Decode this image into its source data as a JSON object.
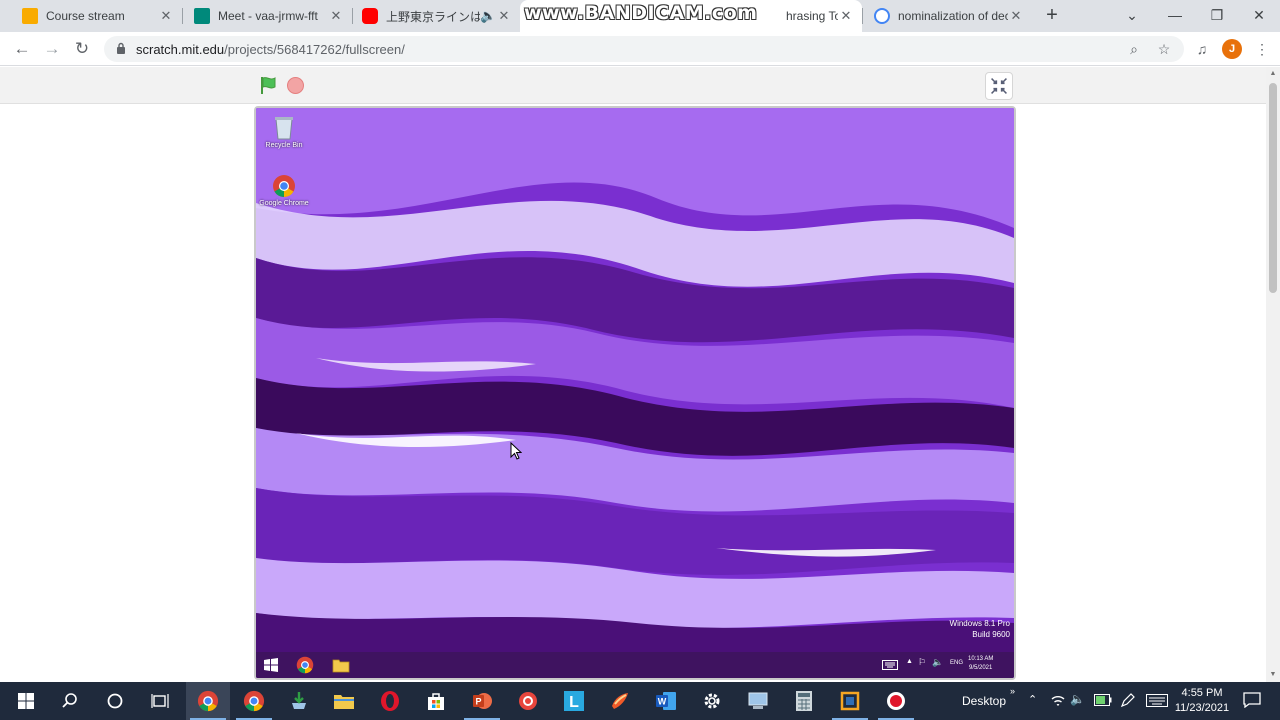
{
  "browser": {
    "tabs": [
      {
        "title": "Course stream",
        "favicon_color": "#f9ab00"
      },
      {
        "title": "Meet - vaa-jrmw-fft",
        "favicon_color": "#00897b"
      },
      {
        "title": "上野東京ラインは大",
        "favicon_color": "#ff0000"
      },
      {
        "title": "hrasing Tool | Qu",
        "favicon_color": "#1a73e8"
      },
      {
        "title": "nominalization of dec",
        "favicon_color": "#4285f4"
      }
    ],
    "active_tab_index": 3,
    "watermark": "www.BANDICAM.com",
    "url": {
      "host": "scratch.mit.edu",
      "path": "/projects/568417262/fullscreen/"
    },
    "profile_initial": "J"
  },
  "scratch": {
    "stage": {
      "desktop_icons": [
        {
          "label": "Recycle Bin",
          "icon": "recycle-bin-icon"
        },
        {
          "label": "Google Chrome",
          "icon": "chrome-icon"
        }
      ],
      "windows_watermark": "Windows 8.1 Pro",
      "windows_build": "Build 9600",
      "inner_clock_time": "10:13 AM",
      "inner_clock_date": "9/5/2021",
      "inner_lang": "ENG",
      "wallpaper_colors": [
        "#3a0a5c",
        "#7a2fd0",
        "#a66bf0",
        "#e8dcff"
      ]
    }
  },
  "taskbar": {
    "apps": [
      "start-icon",
      "search-icon",
      "cortana-icon",
      "task-view-icon",
      "chrome-icon",
      "chrome-icon",
      "installer-icon",
      "file-explorer-icon",
      "opera-icon",
      "store-icon",
      "powerpoint-icon",
      "recorder-icon",
      "l-app-icon",
      "paint-icon",
      "word-icon",
      "settings-icon",
      "computer-icon",
      "calculator-icon",
      "virtualbox-icon",
      "bandicam-record-icon"
    ],
    "desktop_label": "Desktop",
    "time": "4:55 PM",
    "date": "11/23/2021"
  }
}
